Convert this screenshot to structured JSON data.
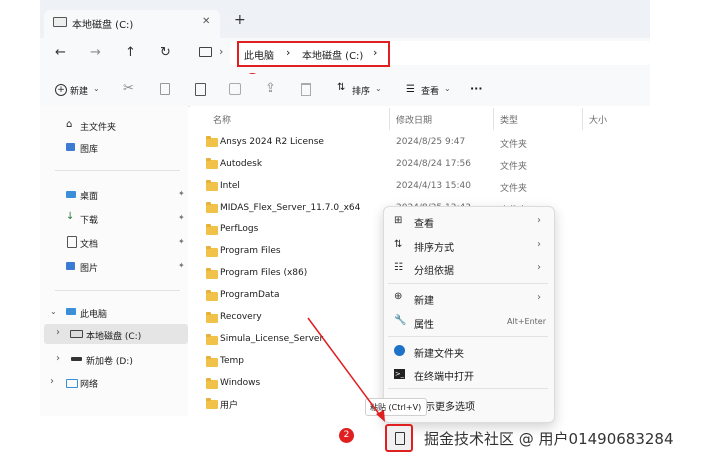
{
  "tab": {
    "title": "本地磁盘 (C:)",
    "close": "✕",
    "new_tab": "+"
  },
  "nav": {
    "back": "←",
    "forward": "→",
    "up": "↑",
    "refresh": "↻"
  },
  "breadcrumb": {
    "root": "此电脑",
    "sep1": "›",
    "current": "本地磁盘 (C:)",
    "sep2": "›"
  },
  "badges": {
    "one": "1",
    "two": "2"
  },
  "toolbar": {
    "new_label": "新建",
    "sort_label": "排序",
    "view_label": "查看",
    "more": "···"
  },
  "headers": {
    "name": "名称",
    "date": "修改日期",
    "type": "类型",
    "size": "大小"
  },
  "sidebar": {
    "home": "主文件夹",
    "gallery": "图库",
    "desktop": "桌面",
    "downloads": "下载",
    "documents": "文档",
    "pictures": "图片",
    "this_pc": "此电脑",
    "drive_c": "本地磁盘 (C:)",
    "drive_d": "新加卷 (D:)",
    "network": "网络"
  },
  "files": [
    {
      "name": "Ansys 2024 R2 License",
      "date": "2024/8/25 9:47",
      "type": "文件夹"
    },
    {
      "name": "Autodesk",
      "date": "2024/8/24 17:56",
      "type": "文件夹"
    },
    {
      "name": "Intel",
      "date": "2024/4/13 15:40",
      "type": "文件夹"
    },
    {
      "name": "MIDAS_Flex_Server_11.7.0_x64",
      "date": "2024/8/25 12:43",
      "type": "文件夹"
    },
    {
      "name": "PerfLogs",
      "date": "",
      "type": ""
    },
    {
      "name": "Program Files",
      "date": "",
      "type": ""
    },
    {
      "name": "Program Files (x86)",
      "date": "",
      "type": ""
    },
    {
      "name": "ProgramData",
      "date": "",
      "type": ""
    },
    {
      "name": "Recovery",
      "date": "",
      "type": ""
    },
    {
      "name": "Simula_License_Server",
      "date": "",
      "type": ""
    },
    {
      "name": "Temp",
      "date": "",
      "type": ""
    },
    {
      "name": "Windows",
      "date": "",
      "type": ""
    },
    {
      "name": "用户",
      "date": "",
      "type": ""
    }
  ],
  "context_menu": {
    "view": "查看",
    "sort": "排序方式",
    "group": "分组依据",
    "new": "新建",
    "properties": "属性",
    "properties_shortcut": "Alt+Enter",
    "new_folder": "新建文件夹",
    "open_terminal": "在终端中打开",
    "more_options": "示更多选项"
  },
  "tooltip": "粘贴 (Ctrl+V)",
  "watermark": "掘金技术社区 @ 用户01490683284"
}
